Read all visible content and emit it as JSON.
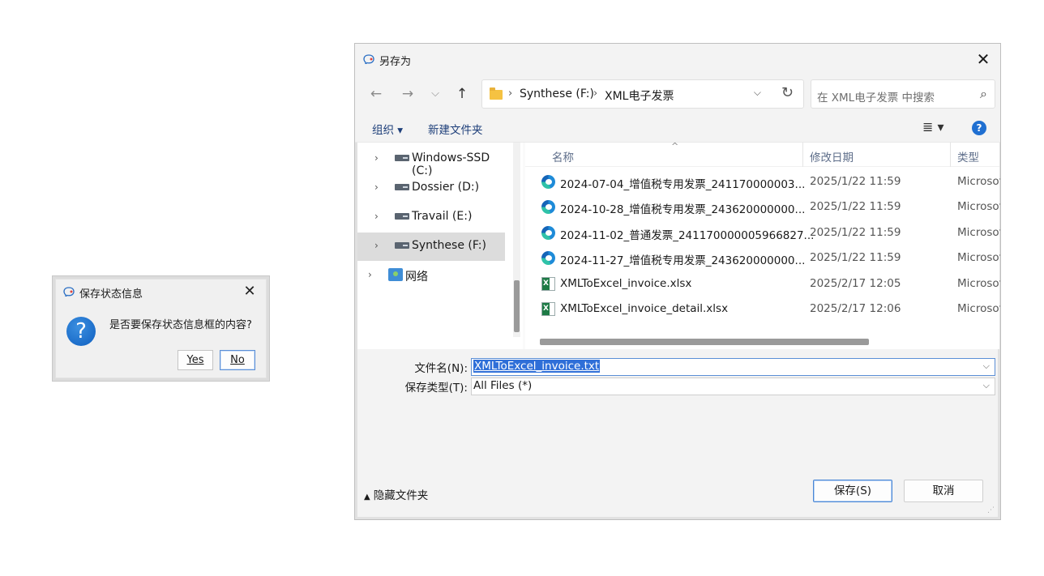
{
  "message_box": {
    "title": "保存状态信息",
    "icon": "question-icon",
    "question": "是否要保存状态信息框的内容?",
    "yes_label": "Yes",
    "no_label": "No",
    "close_glyph": "✕"
  },
  "save_dialog": {
    "title": "另存为",
    "close_glyph": "✕",
    "nav": {
      "back_glyph": "←",
      "forward_glyph": "→",
      "recent_glyph": "⌵",
      "up_glyph": "↑"
    },
    "address": {
      "crumbs": [
        "Synthese (F:)",
        "XML电子发票"
      ],
      "separator": "›",
      "dropdown_glyph": "⌵",
      "refresh_glyph": "↻"
    },
    "search": {
      "placeholder": "在 XML电子发票 中搜索",
      "icon_glyph": "⌕"
    },
    "toolbar": {
      "organize_label": "组织 ▾",
      "new_folder_label": "新建文件夹",
      "view_glyph": "≣ ▾",
      "help_glyph": "?"
    },
    "nav_pane": {
      "items": [
        {
          "label": "Windows-SSD (C:)",
          "type": "drive",
          "selected": false
        },
        {
          "label": "Dossier (D:)",
          "type": "drive",
          "selected": false
        },
        {
          "label": "Travail (E:)",
          "type": "drive",
          "selected": false
        },
        {
          "label": "Synthese (F:)",
          "type": "drive",
          "selected": true
        },
        {
          "label": "网络",
          "type": "network",
          "selected": false
        }
      ],
      "chevron": "›"
    },
    "file_list": {
      "columns": {
        "name": "名称",
        "modified": "修改日期",
        "type": "类型"
      },
      "sort_glyph": "^",
      "rows": [
        {
          "name": "2024-07-04_增值税专用发票_241170000003...",
          "modified": "2025/1/22 11:59",
          "type": "Microsof",
          "icon": "edge-icon"
        },
        {
          "name": "2024-10-28_增值税专用发票_243620000000...",
          "modified": "2025/1/22 11:59",
          "type": "Microsof",
          "icon": "edge-icon"
        },
        {
          "name": "2024-11-02_普通发票_241170000005966827...",
          "modified": "2025/1/22 11:59",
          "type": "Microsof",
          "icon": "edge-icon"
        },
        {
          "name": "2024-11-27_增值税专用发票_243620000000...",
          "modified": "2025/1/22 11:59",
          "type": "Microsof",
          "icon": "edge-icon"
        },
        {
          "name": "XMLToExcel_invoice.xlsx",
          "modified": "2025/2/17 12:05",
          "type": "Microsof",
          "icon": "excel-icon"
        },
        {
          "name": "XMLToExcel_invoice_detail.xlsx",
          "modified": "2025/2/17 12:06",
          "type": "Microsof",
          "icon": "excel-icon"
        }
      ]
    },
    "filename": {
      "label": "文件名(N):",
      "value": "XMLToExcel_invoice.txt",
      "dropdown_glyph": "⌵"
    },
    "filetype": {
      "label": "保存类型(T):",
      "value": "All Files (*)",
      "dropdown_glyph": "⌵"
    },
    "hide_folders": {
      "label": "隐藏文件夹",
      "glyph": "▲"
    },
    "save_label": "保存(S)",
    "cancel_label": "取消"
  }
}
